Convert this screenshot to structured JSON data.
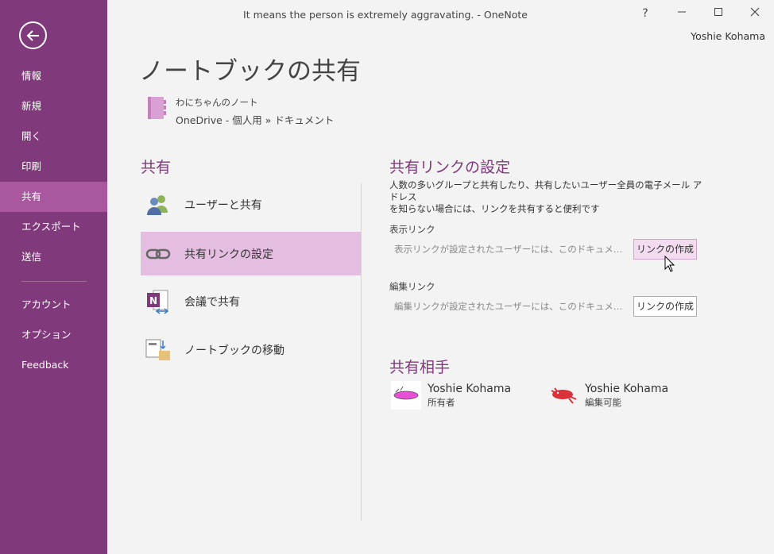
{
  "window": {
    "title": "It means the person is extremely aggravating. - OneNote",
    "help": "?",
    "user": "Yoshie Kohama"
  },
  "sidebar": {
    "items": [
      {
        "label": "情報"
      },
      {
        "label": "新規"
      },
      {
        "label": "開く"
      },
      {
        "label": "印刷"
      },
      {
        "label": "共有"
      },
      {
        "label": "エクスポート"
      },
      {
        "label": "送信"
      },
      {
        "label": "アカウント"
      },
      {
        "label": "オプション"
      },
      {
        "label": "Feedback"
      }
    ],
    "active": "共有"
  },
  "page": {
    "title": "ノートブックの共有",
    "notebook_name": "わにちゃんのノート",
    "notebook_path": "OneDrive - 個人用 » ドキュメント"
  },
  "share": {
    "heading": "共有",
    "items": [
      {
        "label": "ユーザーと共有",
        "icon": "users-icon"
      },
      {
        "label": "共有リンクの設定",
        "icon": "link-icon"
      },
      {
        "label": "会議で共有",
        "icon": "onenote-meeting-icon"
      },
      {
        "label": "ノートブックの移動",
        "icon": "move-notebook-icon"
      }
    ],
    "selected": "共有リンクの設定"
  },
  "link_settings": {
    "heading": "共有リンクの設定",
    "description_line1": "人数の多いグループと共有したり、共有したいユーザー全員の電子メール アドレス",
    "description_line2": "を知らない場合には、リンクを共有すると便利です",
    "view": {
      "label": "表示リンク",
      "text": "表示リンクが設定されたユーザーには、このドキュメントへのアクセス権があります",
      "button": "リンクの作成"
    },
    "edit": {
      "label": "編集リンク",
      "text": "編集リンクが設定されたユーザーには、このドキュメントへのアクセス権があります",
      "button": "リンクの作成"
    }
  },
  "shared_with": {
    "heading": "共有相手",
    "people": [
      {
        "name": "Yoshie Kohama",
        "role": "所有者"
      },
      {
        "name": "Yoshie Kohama",
        "role": "編集可能"
      }
    ]
  },
  "colors": {
    "sidebar": "#80397b",
    "accent": "#80397b",
    "selected": "#e4bee0"
  }
}
